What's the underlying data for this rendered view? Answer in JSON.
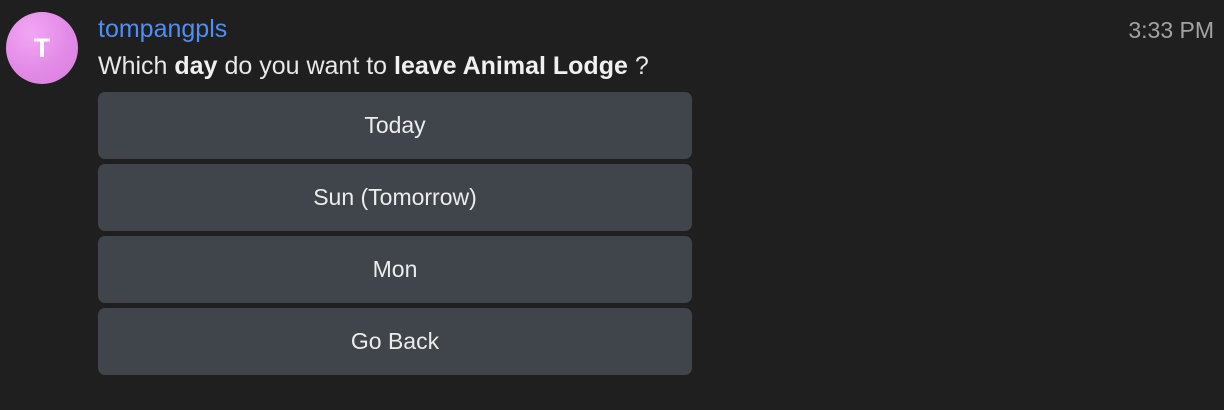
{
  "message": {
    "avatar_letter": "T",
    "username": "tompangpls",
    "timestamp": "3:33 PM",
    "text_parts": {
      "p1": "Which ",
      "b1": "day",
      "p2": " do you want to ",
      "b2": "leave Animal Lodge",
      "p3": " ?"
    }
  },
  "options": [
    {
      "label": "Today"
    },
    {
      "label": "Sun (Tomorrow)"
    },
    {
      "label": "Mon"
    },
    {
      "label": "Go Back"
    }
  ],
  "colors": {
    "background": "#1f1f1f",
    "username": "#4d8ef7",
    "button_bg": "#40444b",
    "avatar": "#e28ae6"
  }
}
